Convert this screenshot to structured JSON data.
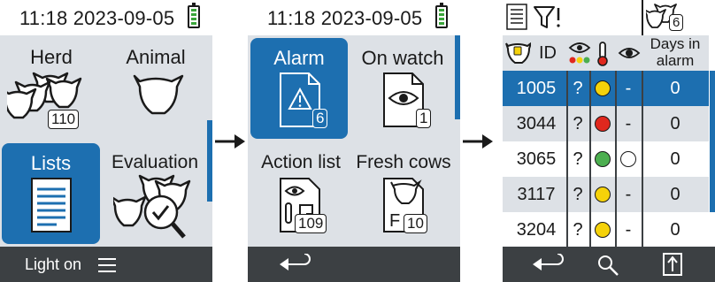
{
  "screen1": {
    "time": "11:18 2023-09-05",
    "tiles": [
      {
        "label": "Herd",
        "badge": "110"
      },
      {
        "label": "Animal"
      },
      {
        "label": "Lists"
      },
      {
        "label": "Evaluation"
      }
    ],
    "footer": {
      "light_label": "Light on",
      "menu_icon": "menu-icon"
    }
  },
  "screen2": {
    "time": "11:18 2023-09-05",
    "tiles": [
      {
        "label": "Alarm",
        "badge": "6"
      },
      {
        "label": "On watch",
        "badge": "1"
      },
      {
        "label": "Action list",
        "badge": "109"
      },
      {
        "label": "Fresh cows",
        "badge": "10"
      }
    ],
    "footer": {
      "back_icon": "back-icon"
    }
  },
  "screen3": {
    "top_badge": "6",
    "header": {
      "id_label": "ID",
      "days_label": "Days in alarm"
    },
    "rows": [
      {
        "id": "1005",
        "q": "?",
        "status": "yellow",
        "watch": "-",
        "days": "0"
      },
      {
        "id": "3044",
        "q": "?",
        "status": "red",
        "watch": "-",
        "days": "0"
      },
      {
        "id": "3065",
        "q": "?",
        "status": "green",
        "watch": "circle",
        "days": "0"
      },
      {
        "id": "3117",
        "q": "?",
        "status": "yellow",
        "watch": "-",
        "days": "0"
      },
      {
        "id": "3204",
        "q": "?",
        "status": "yellow",
        "watch": "-",
        "days": "0"
      }
    ],
    "colors": {
      "yellow": "#f5d20a",
      "red": "#e0281e",
      "green": "#4caf50",
      "accent": "#1d6fb0"
    },
    "footer": {
      "icons": [
        "back-icon",
        "search-icon",
        "export-icon"
      ]
    }
  }
}
